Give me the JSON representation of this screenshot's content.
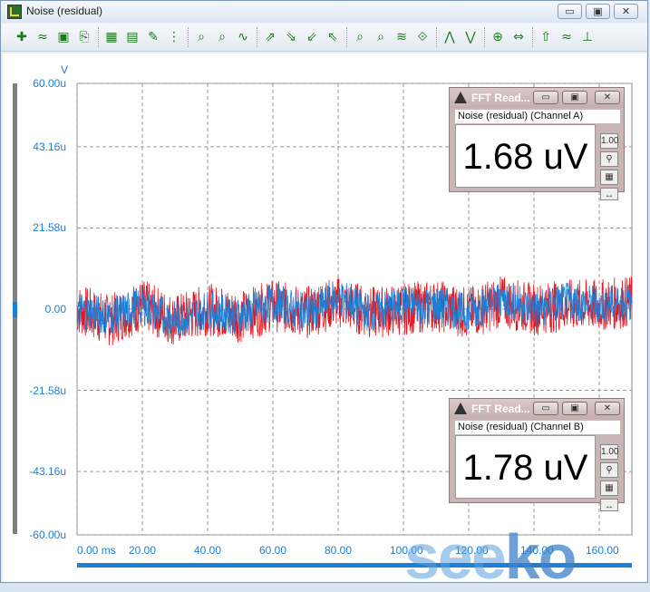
{
  "window": {
    "title": "Noise (residual)",
    "buttons": {
      "minimize": "▭",
      "restore": "▣",
      "close": "✕"
    }
  },
  "toolbar": {
    "icons": [
      "add-trace-icon",
      "wave-icon",
      "save-icon",
      "copy-icon",
      "graph-view-icon",
      "graph-settings-icon",
      "edit-icon",
      "grid-icon",
      "zoom-x-icon",
      "zoom-fit-icon",
      "autoscale-icon",
      "cursor-left-icon",
      "cursor-down-icon",
      "cursor-up-icon",
      "cursor-right-icon",
      "zoom-in-icon",
      "zoom-out-icon",
      "compare-icon",
      "markers-icon",
      "peak-up-icon",
      "peak-down-icon",
      "trigger-icon",
      "fft-icon",
      "arrow-icon",
      "wave-2-icon",
      "tool-icon"
    ],
    "glyphs": [
      "✚",
      "≈",
      "▣",
      "⎘",
      "▦",
      "▤",
      "✎",
      "⋮",
      "⌕",
      "⌕",
      "∿",
      "⇗",
      "⇘",
      "⇙",
      "⇖",
      "⌕",
      "⌕",
      "≋",
      "⟐",
      "⋀",
      "⋁",
      "⊕",
      "⇔",
      "⇧",
      "≈",
      "⊥"
    ]
  },
  "graph": {
    "y_unit": "V",
    "y_ticks": [
      "60.00u",
      "43.16u",
      "21.58u",
      "0.00",
      "-21.58u",
      "-43.16u",
      "-60.00u"
    ],
    "x_ticks": [
      "0.00 ms",
      "20.00",
      "40.00",
      "60.00",
      "80.00",
      "100.00",
      "120.00",
      "140.00",
      "160.00"
    ],
    "colors": {
      "channel_a": "#e8141c",
      "channel_b": "#1e7fd6",
      "grid": "#9a9a9a",
      "axis_text": "#1e7fd6"
    }
  },
  "chart_data": {
    "type": "line",
    "x_unit": "ms",
    "y_unit": "V",
    "xlim": [
      0,
      170
    ],
    "ylim": [
      -60,
      60
    ],
    "series": [
      {
        "name": "Channel A",
        "color": "#e8141c",
        "x": [
          0,
          10,
          20,
          30,
          40,
          50,
          60,
          70,
          80,
          90,
          100,
          110,
          120,
          130,
          140,
          150,
          160,
          170
        ],
        "values": [
          0,
          -3,
          1,
          -3,
          0,
          -2,
          1,
          -1,
          2,
          -1,
          0,
          1,
          -1,
          2,
          0,
          1,
          1,
          2
        ]
      },
      {
        "name": "Channel B",
        "color": "#1e7fd6",
        "x": [
          0,
          10,
          20,
          30,
          40,
          50,
          60,
          70,
          80,
          90,
          100,
          110,
          120,
          130,
          140,
          150,
          160,
          170
        ],
        "values": [
          0,
          -2,
          1,
          -3,
          0,
          -2,
          2,
          -1,
          3,
          -1,
          1,
          1,
          -1,
          3,
          0,
          2,
          1,
          2
        ]
      }
    ]
  },
  "fft_a": {
    "title": "FFT Read...",
    "subtitle": "Noise (residual) (Channel A)",
    "value": "1.68 uV",
    "side_buttons": [
      "1.00",
      "⚲",
      "▦",
      "↔"
    ]
  },
  "fft_b": {
    "title": "FFT Read...",
    "subtitle": "Noise (residual) (Channel B)",
    "value": "1.78 uV",
    "side_buttons": [
      "1.00",
      "⚲",
      "▦",
      "↔"
    ]
  },
  "watermark": {
    "light": "see",
    "dark": "ko"
  }
}
